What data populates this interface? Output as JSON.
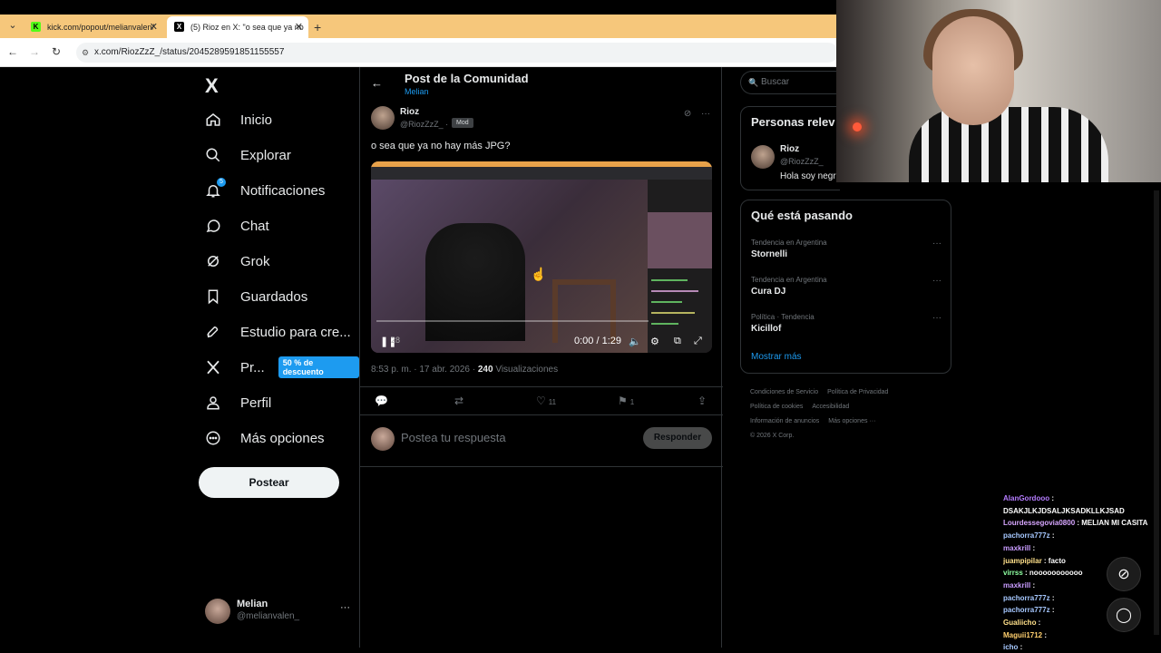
{
  "browser": {
    "tabs": [
      {
        "title": "kick.com/popout/melianvalen/",
        "favicon": "K"
      },
      {
        "title": "(5) Rioz en X: \"o sea que ya no",
        "favicon": "X"
      }
    ],
    "new_tab": "+",
    "url": "x.com/RiozZzZ_/status/2045289591851155557"
  },
  "nav": {
    "logo": "X",
    "notifications_badge": "5",
    "items": [
      {
        "label": "Inicio",
        "icon": "home-icon"
      },
      {
        "label": "Explorar",
        "icon": "search-icon"
      },
      {
        "label": "Notificaciones",
        "icon": "bell-icon"
      },
      {
        "label": "Chat",
        "icon": "chat-icon"
      },
      {
        "label": "Grok",
        "icon": "grok-icon"
      },
      {
        "label": "Guardados",
        "icon": "bookmark-icon"
      },
      {
        "label": "Estudio para cre...",
        "icon": "rocket-icon"
      },
      {
        "label": "Pr...",
        "icon": "x-icon"
      },
      {
        "label": "Perfil",
        "icon": "person-icon"
      },
      {
        "label": "Más opciones",
        "icon": "more-circle-icon"
      }
    ],
    "promo": "50 % de descuento",
    "post_button": "Postear",
    "account": {
      "name": "Melian",
      "handle": "@melianvalen_",
      "more": "···"
    }
  },
  "post": {
    "header_title": "Post de la Comunidad",
    "header_sub": "Melian",
    "author_name": "Rioz",
    "author_handle": "@RiozZzZ_ ·",
    "role_badge": "Mod",
    "text": "o sea que ya no hay más JPG?",
    "video": {
      "time": "0:00 / 1:29",
      "progress": 0,
      "playhead_label": "28"
    },
    "time": "8:53 p. m. · 17 abr. 2026 ·",
    "views": "240",
    "views_label": "Visualizaciones",
    "likes": "11",
    "bookmarks": "1",
    "reply_placeholder": "Postea tu respuesta",
    "reply_button": "Responder"
  },
  "sidebar": {
    "search_placeholder": "Buscar",
    "people_title": "Personas relev",
    "person": {
      "name": "Rioz",
      "handle": "@RiozZzZ_",
      "bio": "Hola soy negr"
    },
    "trends_title": "Qué está pasando",
    "trends": [
      {
        "category": "Tendencia en Argentina",
        "name": "Stornelli"
      },
      {
        "category": "Tendencia en Argentina",
        "name": "Cura DJ"
      },
      {
        "category": "Política · Tendencia",
        "name": "Kicillof"
      }
    ],
    "show_more": "Mostrar más",
    "footer": [
      "Condiciones de Servicio",
      "Política de Privacidad",
      "Política de cookies",
      "Accesibilidad",
      "Información de anuncios",
      "Más opciones ···",
      "© 2026 X Corp."
    ]
  },
  "chat": [
    {
      "user": "AlanGordooo",
      "msg": ":",
      "color": "#b57cff"
    },
    {
      "user": "",
      "msg": "DSAKJLKJDSALJKSADKLLKJSAD",
      "color": "#fff"
    },
    {
      "user": "Lourdessegovia0800",
      "msg": ": MELIAN MI CASITA",
      "color": "#d7a6ff"
    },
    {
      "user": "pachorra777z",
      "msg": ":",
      "color": "#a6c8ff"
    },
    {
      "user": "maxkrill",
      "msg": ":",
      "color": "#c99cff"
    },
    {
      "user": "juampipilar",
      "msg": ": facto",
      "color": "#ffe08a"
    },
    {
      "user": "virrss",
      "msg": ": nooooooooooo",
      "color": "#8effa1"
    },
    {
      "user": "maxkrill",
      "msg": ":",
      "color": "#c99cff"
    },
    {
      "user": "pachorra777z",
      "msg": ":",
      "color": "#a6c8ff"
    },
    {
      "user": "pachorra777z",
      "msg": ":",
      "color": "#a6c8ff"
    },
    {
      "user": "Gualiicho",
      "msg": ":",
      "color": "#ffe08a"
    },
    {
      "user": "Maguii1712",
      "msg": ":",
      "color": "#ffcf6e"
    },
    {
      "user": "icho",
      "msg": ":",
      "color": "#a6c8ff"
    }
  ]
}
